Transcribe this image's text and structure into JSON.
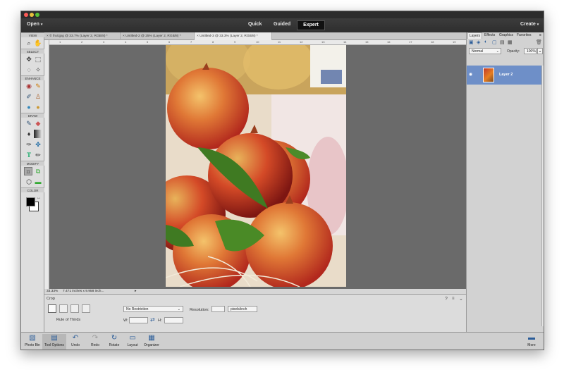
{
  "topbar": {
    "open": "Open",
    "quick": "Quick",
    "guided": "Guided",
    "expert": "Expert",
    "create": "Create"
  },
  "toolbox": {
    "sections": {
      "view": "VIEW",
      "select": "SELECT",
      "enhance": "ENHANCE",
      "draw": "DRAW",
      "modify": "MODIFY",
      "color": "COLOR"
    },
    "foreground_color": "#000000",
    "background_color": "#ffffff"
  },
  "tabs": [
    {
      "label": "© fruit.jpg @ 33.7% (Layer 2, RGB/8) *"
    },
    {
      "label": "Untitled-2 @ 25% (Layer 2, RGB/8) *"
    },
    {
      "label": "Untitled-3 @ 33.3% (Layer 2, RGB/8) *"
    }
  ],
  "rulers": {
    "top": [
      "1",
      "2",
      "3",
      "4",
      "5",
      "6",
      "7",
      "8",
      "9",
      "10",
      "11",
      "12",
      "13",
      "14",
      "15",
      "16",
      "17",
      "18",
      "19"
    ]
  },
  "status": {
    "zoom": "33.33%",
    "size": "7.471 inches x 9.958 inch..."
  },
  "options": {
    "tool_name": "Crop",
    "overlay_label": "Rule of Thirds",
    "preset": "No Restriction",
    "w_label": "W:",
    "h_label": "H:",
    "resolution_label": "Resolution:",
    "unit": "pixels/inch"
  },
  "panel": {
    "tabs": [
      "Layers",
      "Effects",
      "Graphics",
      "Favorites"
    ],
    "blend_mode": "Normal",
    "opacity_label": "Opacity:",
    "opacity_value": "100%",
    "layer_name": "Layer 2"
  },
  "bottombar": {
    "left": [
      "Photo Bin",
      "Tool Options",
      "Undo",
      "Redo",
      "Rotate",
      "Layout",
      "Organizer"
    ],
    "right": "More"
  },
  "colors": {
    "accent": "#6e8fc8",
    "canvas": "#6a6a6a",
    "chrome": "#2e2e2e"
  }
}
